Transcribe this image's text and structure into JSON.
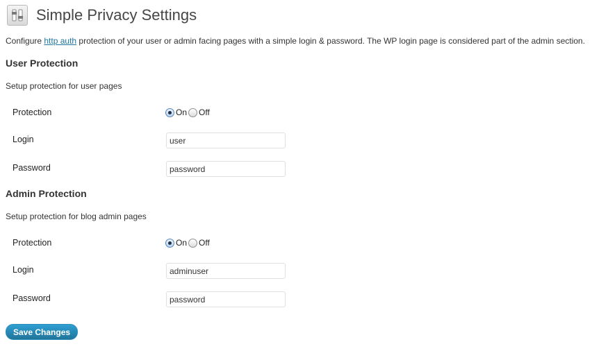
{
  "header": {
    "title": "Simple Privacy Settings",
    "icon": "settings-sliders-icon"
  },
  "intro": {
    "before_link": "Configure ",
    "link_text": "http auth",
    "after_link": " protection of your user or admin facing pages with a simple login & password. The WP login page is considered part of the admin section."
  },
  "user_section": {
    "title": "User Protection",
    "description": "Setup protection for user pages",
    "protection_label": "Protection",
    "on_label": "On",
    "off_label": "Off",
    "protection_value": "On",
    "login_label": "Login",
    "login_value": "user",
    "password_label": "Password",
    "password_value": "password"
  },
  "admin_section": {
    "title": "Admin Protection",
    "description": "Setup protection for blog admin pages",
    "protection_label": "Protection",
    "on_label": "On",
    "off_label": "Off",
    "protection_value": "On",
    "login_label": "Login",
    "login_value": "adminuser",
    "password_label": "Password",
    "password_value": "password"
  },
  "save_button_label": "Save Changes",
  "colors": {
    "link": "#21759b",
    "button": "#21759b"
  }
}
